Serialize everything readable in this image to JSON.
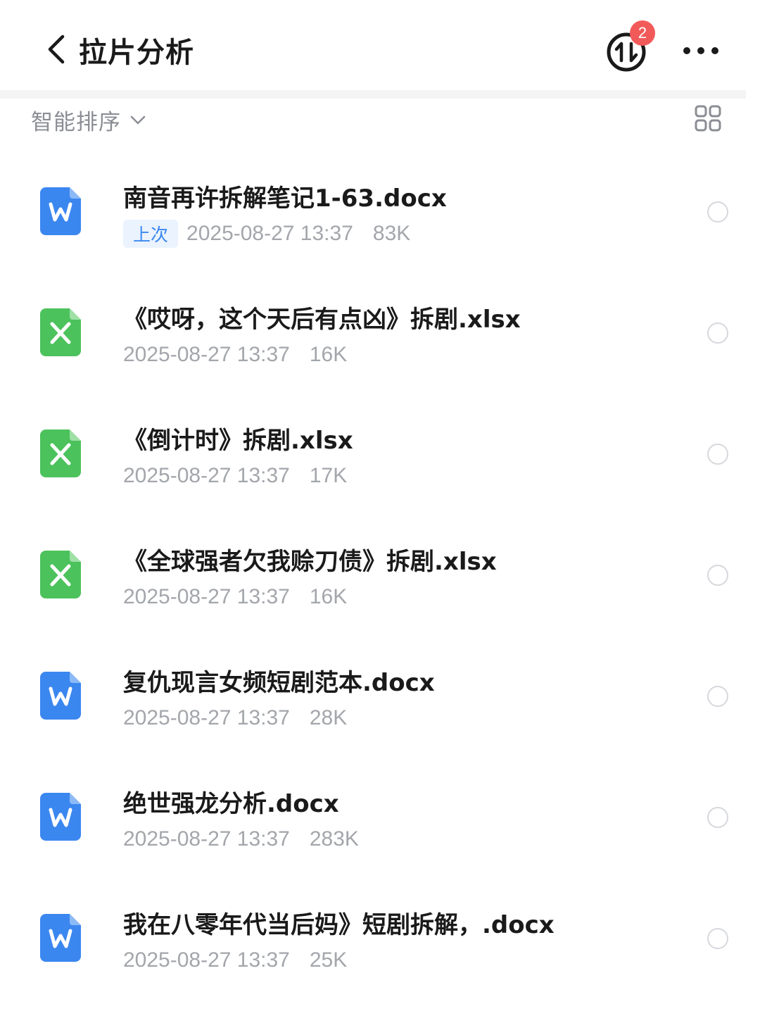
{
  "header": {
    "title": "拉片分析",
    "badge_count": "2",
    "icons": {
      "back": "chevron-left-icon",
      "transfer": "transfer-icon",
      "more": "more-dots-icon"
    }
  },
  "sortbar": {
    "label": "智能排序",
    "icons": {
      "chevron": "chevron-down-icon",
      "grid": "grid-view-icon"
    }
  },
  "colors": {
    "word_blue": "#3b87f0",
    "excel_green": "#4cc25c",
    "badge_red": "#f25a5a",
    "meta_gray": "#a3a6ab"
  },
  "files": [
    {
      "name": "南音再许拆解笔记1-63.docx",
      "type": "word",
      "tag": "上次",
      "date": "2025-08-27 13:37",
      "size": "83K"
    },
    {
      "name": "《哎呀，这个天后有点凶》拆剧.xlsx",
      "type": "excel",
      "tag": "",
      "date": "2025-08-27 13:37",
      "size": "16K"
    },
    {
      "name": "《倒计时》拆剧.xlsx",
      "type": "excel",
      "tag": "",
      "date": "2025-08-27 13:37",
      "size": "17K"
    },
    {
      "name": "《全球强者欠我赊刀债》拆剧.xlsx",
      "type": "excel",
      "tag": "",
      "date": "2025-08-27 13:37",
      "size": "16K"
    },
    {
      "name": "复仇现言女频短剧范本.docx",
      "type": "word",
      "tag": "",
      "date": "2025-08-27 13:37",
      "size": "28K"
    },
    {
      "name": "绝世强龙分析.docx",
      "type": "word",
      "tag": "",
      "date": "2025-08-27 13:37",
      "size": "283K"
    },
    {
      "name": "我在八零年代当后妈》短剧拆解，.docx",
      "type": "word",
      "tag": "",
      "date": "2025-08-27 13:37",
      "size": "25K"
    }
  ]
}
